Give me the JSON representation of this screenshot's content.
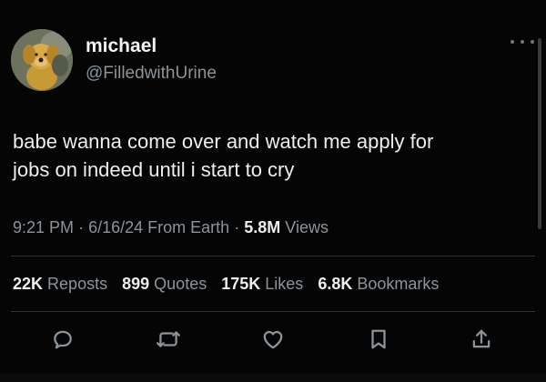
{
  "user": {
    "name": "michael",
    "handle": "@FilledwithUrine"
  },
  "tweet": {
    "text": "babe wanna come over and watch me apply for\njobs on indeed until i start to cry",
    "time": "9:21 PM",
    "date": "6/16/24",
    "source": "From Earth",
    "views_count": "5.8M",
    "views_label": "Views",
    "separator": "·"
  },
  "stats": [
    {
      "count": "22K",
      "label": "Reposts"
    },
    {
      "count": "899",
      "label": "Quotes"
    },
    {
      "count": "175K",
      "label": "Likes"
    },
    {
      "count": "6.8K",
      "label": "Bookmarks"
    }
  ],
  "actions": [
    "reply-icon",
    "repost-icon",
    "like-icon",
    "bookmark-icon",
    "share-icon"
  ],
  "colors": {
    "background": "#050505",
    "text": "#eceeef",
    "muted": "#8b949b",
    "divider": "#2f3336",
    "icon": "#8b949b"
  }
}
